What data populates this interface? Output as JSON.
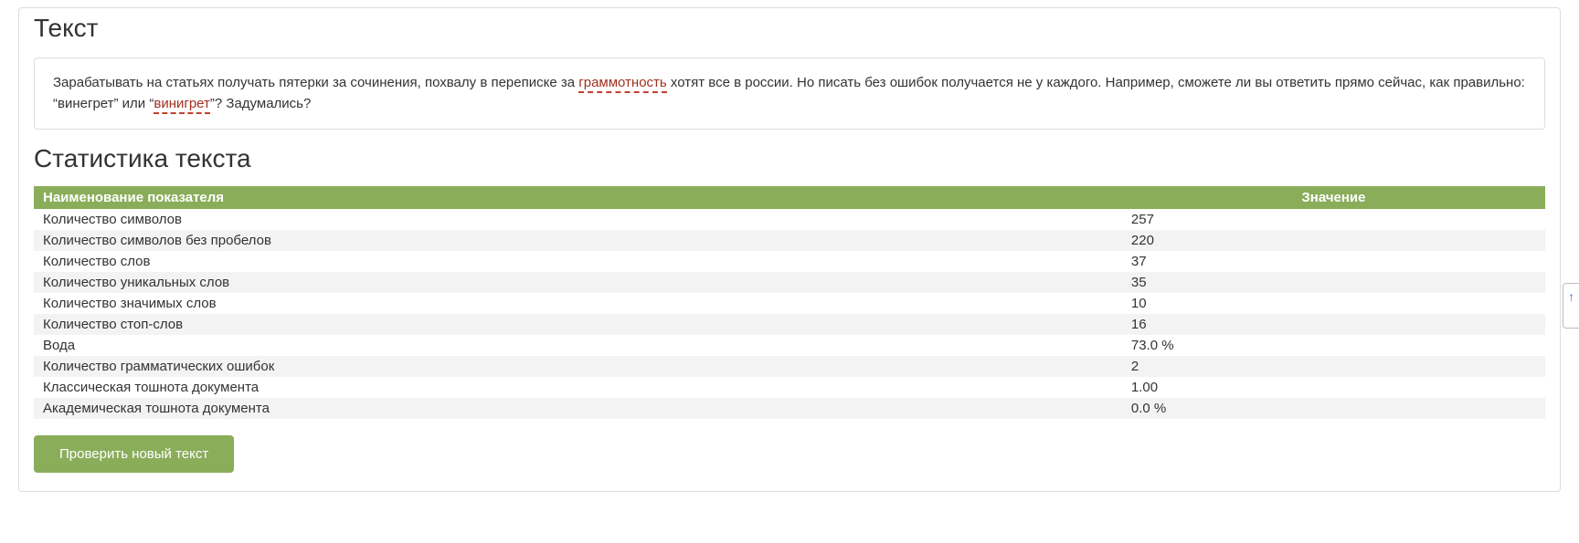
{
  "sections": {
    "text_heading": "Текст",
    "stats_heading": "Статистика текста"
  },
  "analyzed_text": {
    "part1": "Зарабатывать на статьях получать пятерки за сочинения, похвалу в переписке за ",
    "error1": "граммотность",
    "part2": " хотят все в россии. Но писать без ошибок получается не у каждого. Например, сможете ли вы ответить прямо сейчас, как правильно: “винегрет” или “",
    "error2": "винигрет",
    "part3": "”? Задумались?"
  },
  "stats_header": {
    "name": "Наименование показателя",
    "value": "Значение"
  },
  "stats": [
    {
      "name": "Количество символов",
      "value": "257"
    },
    {
      "name": "Количество символов без пробелов",
      "value": "220"
    },
    {
      "name": "Количество слов",
      "value": "37"
    },
    {
      "name": "Количество уникальных слов",
      "value": "35"
    },
    {
      "name": "Количество значимых слов",
      "value": "10"
    },
    {
      "name": "Количество стоп-слов",
      "value": "16"
    },
    {
      "name": "Вода",
      "value": "73.0 %"
    },
    {
      "name": "Количество грамматических ошибок",
      "value": "2"
    },
    {
      "name": "Классическая тошнота документа",
      "value": "1.00"
    },
    {
      "name": "Академическая тошнота документа",
      "value": "0.0 %"
    }
  ],
  "button": {
    "check_new": "Проверить новый текст"
  },
  "side_tab": {
    "glyph": "↑"
  }
}
